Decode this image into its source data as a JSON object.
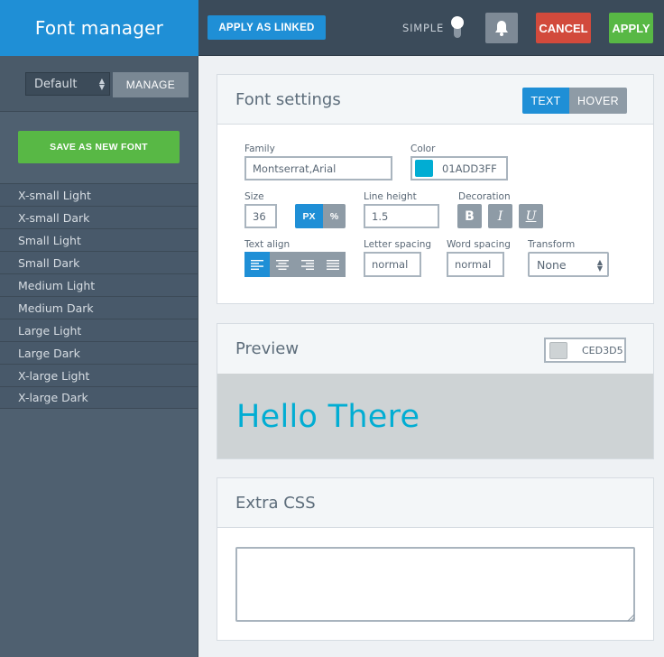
{
  "header": {
    "app_title": "Font manager",
    "apply_linked_label": "APPLY AS LINKED",
    "simple_label": "SIMPLE",
    "cancel_label": "CANCEL",
    "apply_label": "APPLY",
    "bell_icon": "bell-icon"
  },
  "sidebar": {
    "preset_select_value": "Default",
    "manage_label": "MANAGE",
    "save_new_font_label": "SAVE AS NEW FONT",
    "fonts": [
      "X-small Light",
      "X-small Dark",
      "Small Light",
      "Small Dark",
      "Medium Light",
      "Medium Dark",
      "Large Light",
      "Large Dark",
      "X-large Light",
      "X-large Dark"
    ]
  },
  "font_settings": {
    "title": "Font settings",
    "tabs": [
      "TEXT",
      "HOVER"
    ],
    "active_tab": "TEXT",
    "family_label": "Family",
    "family_value": "Montserrat,Arial",
    "color_label": "Color",
    "color_value": "01ADD3FF",
    "color_hex": "#01add3",
    "size_label": "Size",
    "size_value": "36",
    "unit_px": "PX",
    "unit_percent": "%",
    "line_height_label": "Line height",
    "line_height_value": "1.5",
    "decoration_label": "Decoration",
    "decoration_bold": "B",
    "decoration_italic": "I",
    "decoration_underline": "U",
    "text_align_label": "Text align",
    "letter_spacing_label": "Letter spacing",
    "letter_spacing_value": "normal",
    "word_spacing_label": "Word spacing",
    "word_spacing_value": "normal",
    "transform_label": "Transform",
    "transform_value": "None"
  },
  "preview": {
    "title": "Preview",
    "bg_color_value": "CED3D5",
    "bg_color_hex": "#ced3d5",
    "sample_text": "Hello There"
  },
  "extra_css": {
    "title": "Extra CSS",
    "value": ""
  }
}
